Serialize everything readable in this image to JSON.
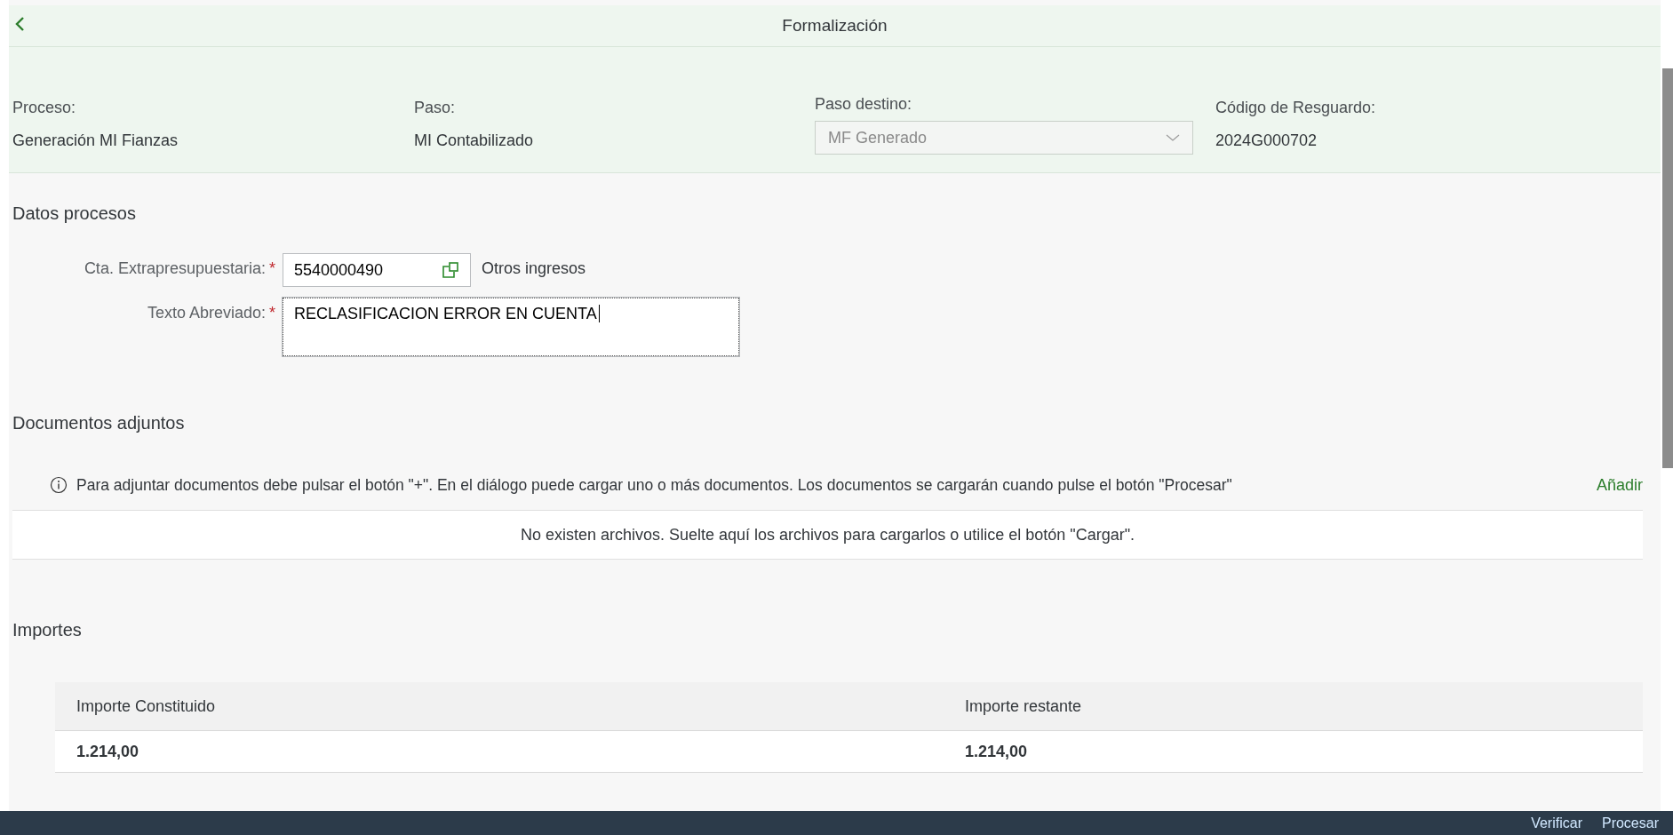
{
  "header": {
    "title": "Formalización",
    "fields": [
      {
        "kind": "text",
        "label": "Proceso:",
        "value": "Generación MI Fianzas"
      },
      {
        "kind": "text",
        "label": "Paso:",
        "value": "MI Contabilizado"
      },
      {
        "kind": "select",
        "label": "Paso destino:",
        "value": "MF Generado",
        "disabled": true
      },
      {
        "kind": "text",
        "label": "Código de Resguardo:",
        "value": "2024G000702"
      }
    ]
  },
  "process_section": {
    "title": "Datos procesos",
    "fields": [
      {
        "kind": "input",
        "label": "Cta. Extrapresupuestaria:",
        "required_mark": "*",
        "value": "5540000490",
        "description": "Otros ingresos"
      },
      {
        "kind": "textarea",
        "label": "Texto Abreviado:",
        "required_mark": "*",
        "value": "RECLASIFICACION ERROR EN CUENTA"
      }
    ]
  },
  "attachments": {
    "title": "Documentos adjuntos",
    "info": "Para adjuntar documentos debe pulsar el botón \"+\". En el diálogo puede cargar uno o más documentos. Los documentos se cargarán cuando pulse el botón \"Procesar\"",
    "add_link": "Añadir",
    "empty_text": "No existen archivos. Suelte aquí los archivos para cargarlos o utilice el botón \"Cargar\"."
  },
  "amounts": {
    "title": "Importes",
    "columns": [
      "Importe Constituido",
      "Importe restante"
    ],
    "rows": [
      [
        "1.214,00",
        "1.214,00"
      ]
    ]
  },
  "footer": {
    "buttons": [
      "Verificar",
      "Procesar"
    ]
  }
}
